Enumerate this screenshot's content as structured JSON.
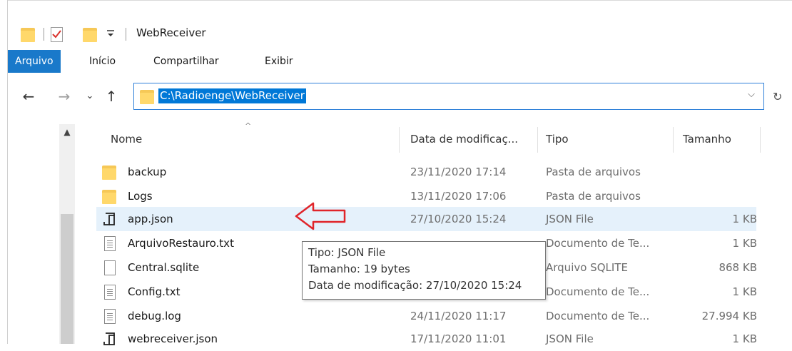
{
  "window": {
    "title": "WebReceiver"
  },
  "ribbon": {
    "tabs": [
      {
        "label": "Arquivo",
        "active": true
      },
      {
        "label": "Início"
      },
      {
        "label": "Compartilhar"
      },
      {
        "label": "Exibir"
      }
    ]
  },
  "address": {
    "path": "C:\\Radioenge\\WebReceiver",
    "icons": {
      "back": "←",
      "forward": "→",
      "recent": "⌄",
      "up": "↑",
      "dropdown": "⌵",
      "refresh": "↻"
    }
  },
  "columns": {
    "name": "Nome",
    "modified": "Data de modificaç...",
    "type": "Tipo",
    "size": "Tamanho"
  },
  "files": [
    {
      "icon": "folder-icon",
      "name": "backup",
      "modified": "23/11/2020 17:14",
      "type": "Pasta de arquivos",
      "size": ""
    },
    {
      "icon": "folder-icon",
      "name": "Logs",
      "modified": "13/11/2020 17:06",
      "type": "Pasta de arquivos",
      "size": ""
    },
    {
      "icon": "json-file-icon",
      "name": "app.json",
      "modified": "27/10/2020 15:24",
      "type": "JSON File",
      "size": "1 KB",
      "selected": true
    },
    {
      "icon": "text-file-icon",
      "name": "ArquivoRestauro.txt",
      "modified": "",
      "type": "Documento de Te...",
      "size": "1 KB"
    },
    {
      "icon": "blank-file-icon",
      "name": "Central.sqlite",
      "modified": "",
      "type": "Arquivo SQLITE",
      "size": "868 KB"
    },
    {
      "icon": "text-file-icon",
      "name": "Config.txt",
      "modified": "",
      "type": "Documento de Te...",
      "size": "1 KB"
    },
    {
      "icon": "text-file-icon",
      "name": "debug.log",
      "modified": "24/11/2020 11:17",
      "type": "Documento de Te...",
      "size": "27.994 KB"
    },
    {
      "icon": "json-file-icon",
      "name": "webreceiver.json",
      "modified": "17/11/2020 11:01",
      "type": "JSON File",
      "size": "1 KB"
    }
  ],
  "tooltip": {
    "type": "Tipo: JSON File",
    "size": "Tamanho: 19 bytes",
    "modified": "Data de modificação: 27/10/2020 15:24"
  },
  "colors": {
    "accent": "#0078d7",
    "tab_active": "#1979ca",
    "arrow": "#e0242a",
    "selection": "#e5f1fb"
  }
}
